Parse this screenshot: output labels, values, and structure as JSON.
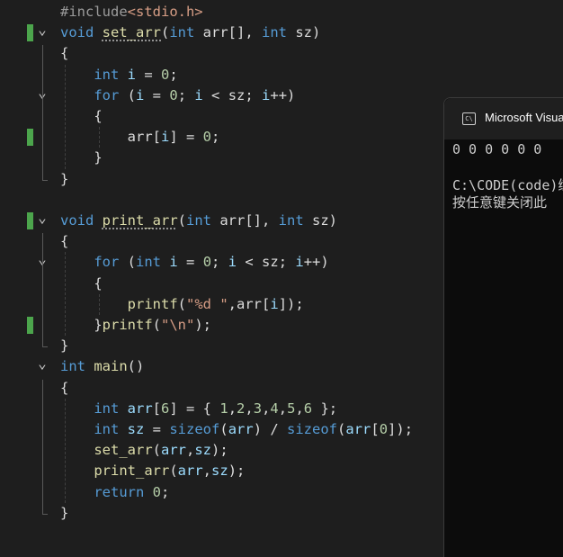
{
  "editor": {
    "lines": [
      [
        [
          "pp",
          "#include"
        ],
        [
          "inc",
          "<stdio.h>"
        ]
      ],
      [
        [
          "ty",
          "void"
        ],
        [
          "pl",
          " "
        ],
        [
          "fn",
          "set_arr",
          true
        ],
        [
          "pl",
          "("
        ],
        [
          "ty",
          "int"
        ],
        [
          "pl",
          " arr[], "
        ],
        [
          "ty",
          "int"
        ],
        [
          "pl",
          " sz)"
        ]
      ],
      [
        [
          "pl",
          "{"
        ]
      ],
      [
        [
          "pl",
          "    "
        ],
        [
          "ty",
          "int"
        ],
        [
          "pl",
          " "
        ],
        [
          "id",
          "i"
        ],
        [
          "pl",
          " = "
        ],
        [
          "num",
          "0"
        ],
        [
          "pl",
          ";"
        ]
      ],
      [
        [
          "pl",
          "    "
        ],
        [
          "kw",
          "for"
        ],
        [
          "pl",
          " ("
        ],
        [
          "id",
          "i"
        ],
        [
          "pl",
          " = "
        ],
        [
          "num",
          "0"
        ],
        [
          "pl",
          "; "
        ],
        [
          "id",
          "i"
        ],
        [
          "pl",
          " < sz; "
        ],
        [
          "id",
          "i"
        ],
        [
          "pl",
          "++)"
        ]
      ],
      [
        [
          "pl",
          "    {"
        ]
      ],
      [
        [
          "pl",
          "        arr["
        ],
        [
          "id",
          "i"
        ],
        [
          "pl",
          "] = "
        ],
        [
          "num",
          "0"
        ],
        [
          "pl",
          ";"
        ]
      ],
      [
        [
          "pl",
          "    }"
        ]
      ],
      [
        [
          "pl",
          "}"
        ]
      ],
      [
        [
          "pl",
          ""
        ]
      ],
      [
        [
          "ty",
          "void"
        ],
        [
          "pl",
          " "
        ],
        [
          "fn",
          "print_arr",
          true
        ],
        [
          "pl",
          "("
        ],
        [
          "ty",
          "int"
        ],
        [
          "pl",
          " arr[], "
        ],
        [
          "ty",
          "int"
        ],
        [
          "pl",
          " sz)"
        ]
      ],
      [
        [
          "pl",
          "{"
        ]
      ],
      [
        [
          "pl",
          "    "
        ],
        [
          "kw",
          "for"
        ],
        [
          "pl",
          " ("
        ],
        [
          "ty",
          "int"
        ],
        [
          "pl",
          " "
        ],
        [
          "id",
          "i"
        ],
        [
          "pl",
          " = "
        ],
        [
          "num",
          "0"
        ],
        [
          "pl",
          "; "
        ],
        [
          "id",
          "i"
        ],
        [
          "pl",
          " < sz; "
        ],
        [
          "id",
          "i"
        ],
        [
          "pl",
          "++)"
        ]
      ],
      [
        [
          "pl",
          "    {"
        ]
      ],
      [
        [
          "pl",
          "        "
        ],
        [
          "fn",
          "printf"
        ],
        [
          "pl",
          "("
        ],
        [
          "str",
          "\"%d \""
        ],
        [
          "pl",
          ",arr["
        ],
        [
          "id",
          "i"
        ],
        [
          "pl",
          "]);"
        ]
      ],
      [
        [
          "pl",
          "    }"
        ],
        [
          "fn",
          "printf"
        ],
        [
          "pl",
          "("
        ],
        [
          "str",
          "\"\\n\""
        ],
        [
          "pl",
          ");"
        ]
      ],
      [
        [
          "pl",
          "}"
        ]
      ],
      [
        [
          "ty",
          "int"
        ],
        [
          "pl",
          " "
        ],
        [
          "fn",
          "main"
        ],
        [
          "pl",
          "()"
        ]
      ],
      [
        [
          "pl",
          "{"
        ]
      ],
      [
        [
          "pl",
          "    "
        ],
        [
          "ty",
          "int"
        ],
        [
          "pl",
          " "
        ],
        [
          "id",
          "arr"
        ],
        [
          "pl",
          "["
        ],
        [
          "num",
          "6"
        ],
        [
          "pl",
          "] = { "
        ],
        [
          "num",
          "1"
        ],
        [
          "pl",
          ","
        ],
        [
          "num",
          "2"
        ],
        [
          "pl",
          ","
        ],
        [
          "num",
          "3"
        ],
        [
          "pl",
          ","
        ],
        [
          "num",
          "4"
        ],
        [
          "pl",
          ","
        ],
        [
          "num",
          "5"
        ],
        [
          "pl",
          ","
        ],
        [
          "num",
          "6"
        ],
        [
          "pl",
          " };"
        ]
      ],
      [
        [
          "pl",
          "    "
        ],
        [
          "ty",
          "int"
        ],
        [
          "pl",
          " "
        ],
        [
          "id",
          "sz"
        ],
        [
          "pl",
          " = "
        ],
        [
          "kw",
          "sizeof"
        ],
        [
          "pl",
          "("
        ],
        [
          "id",
          "arr"
        ],
        [
          "pl",
          ") / "
        ],
        [
          "kw",
          "sizeof"
        ],
        [
          "pl",
          "("
        ],
        [
          "id",
          "arr"
        ],
        [
          "pl",
          "["
        ],
        [
          "num",
          "0"
        ],
        [
          "pl",
          "]);"
        ]
      ],
      [
        [
          "pl",
          "    "
        ],
        [
          "fn",
          "set_arr"
        ],
        [
          "pl",
          "("
        ],
        [
          "id",
          "arr"
        ],
        [
          "pl",
          ","
        ],
        [
          "id",
          "sz"
        ],
        [
          "pl",
          ");"
        ]
      ],
      [
        [
          "pl",
          "    "
        ],
        [
          "fn",
          "print_arr"
        ],
        [
          "pl",
          "("
        ],
        [
          "id",
          "arr"
        ],
        [
          "pl",
          ","
        ],
        [
          "id",
          "sz"
        ],
        [
          "pl",
          ");"
        ]
      ],
      [
        [
          "pl",
          "    "
        ],
        [
          "kw",
          "return"
        ],
        [
          "pl",
          " "
        ],
        [
          "num",
          "0"
        ],
        [
          "pl",
          ";"
        ]
      ],
      [
        [
          "pl",
          "}"
        ]
      ]
    ],
    "modified_lines": [
      1,
      6,
      10,
      15
    ],
    "fold_lines": [
      1,
      4,
      10,
      12,
      17
    ]
  },
  "console": {
    "title": "Microsoft Visual",
    "icon": "console-window-icon",
    "icon_glyph": "C\\",
    "output": [
      "0 0 0 0 0 0",
      "",
      "C:\\CODE(code)练",
      "按任意键关闭此"
    ]
  }
}
